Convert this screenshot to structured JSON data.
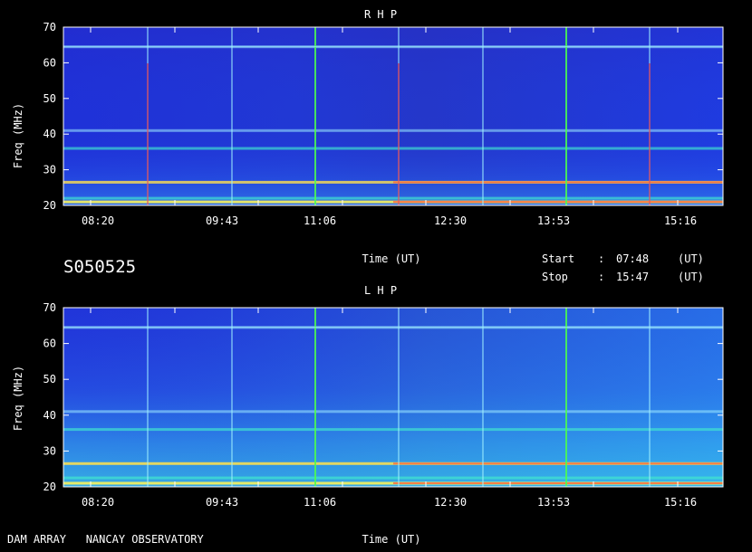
{
  "header": {
    "session_id": "S050525",
    "time_label": "Time (UT)",
    "start_label": "Start",
    "stop_label": "Stop",
    "colon": ":",
    "start_time": "07:48",
    "stop_time": "15:47",
    "ut_label": "(UT)"
  },
  "footer": {
    "observatory": "DAM ARRAY   NANCAY OBSERVATORY",
    "time_label": "Time (UT)"
  },
  "colors": {
    "background": "#000000",
    "spectrum_base": "#1c2bd0",
    "grid_line": "#9ff0ff",
    "marker_green": "#4cff4c",
    "marker_red": "#ff2a2a"
  },
  "chart_data": [
    {
      "type": "heatmap",
      "title": "R H P",
      "ylabel": "Freq (MHz)",
      "xlabel": "Time (UT)",
      "ylim": [
        20,
        70
      ],
      "yticks": [
        20,
        30,
        40,
        50,
        60,
        70
      ],
      "xticks": [
        "08:20",
        "09:43",
        "11:06",
        "12:30",
        "13:53",
        "15:16"
      ],
      "bands": [
        {
          "freq": 21,
          "intensity": 0.95
        },
        {
          "freq": 22,
          "intensity": 0.6
        },
        {
          "freq": 26.5,
          "intensity": 0.75
        },
        {
          "freq": 36,
          "intensity": 0.55
        },
        {
          "freq": 41,
          "intensity": 0.35
        },
        {
          "freq": 64.5,
          "intensity": 0.4
        }
      ]
    },
    {
      "type": "heatmap",
      "title": "L H P",
      "ylabel": "Freq (MHz)",
      "xlabel": "Time (UT)",
      "ylim": [
        20,
        70
      ],
      "yticks": [
        20,
        30,
        40,
        50,
        60,
        70
      ],
      "xticks": [
        "08:20",
        "09:43",
        "11:06",
        "12:30",
        "13:53",
        "15:16"
      ],
      "bands": [
        {
          "freq": 21,
          "intensity": 0.95
        },
        {
          "freq": 22.5,
          "intensity": 0.7
        },
        {
          "freq": 26.5,
          "intensity": 0.85
        },
        {
          "freq": 36,
          "intensity": 0.6
        },
        {
          "freq": 41,
          "intensity": 0.35
        },
        {
          "freq": 64.5,
          "intensity": 0.4
        }
      ]
    }
  ]
}
